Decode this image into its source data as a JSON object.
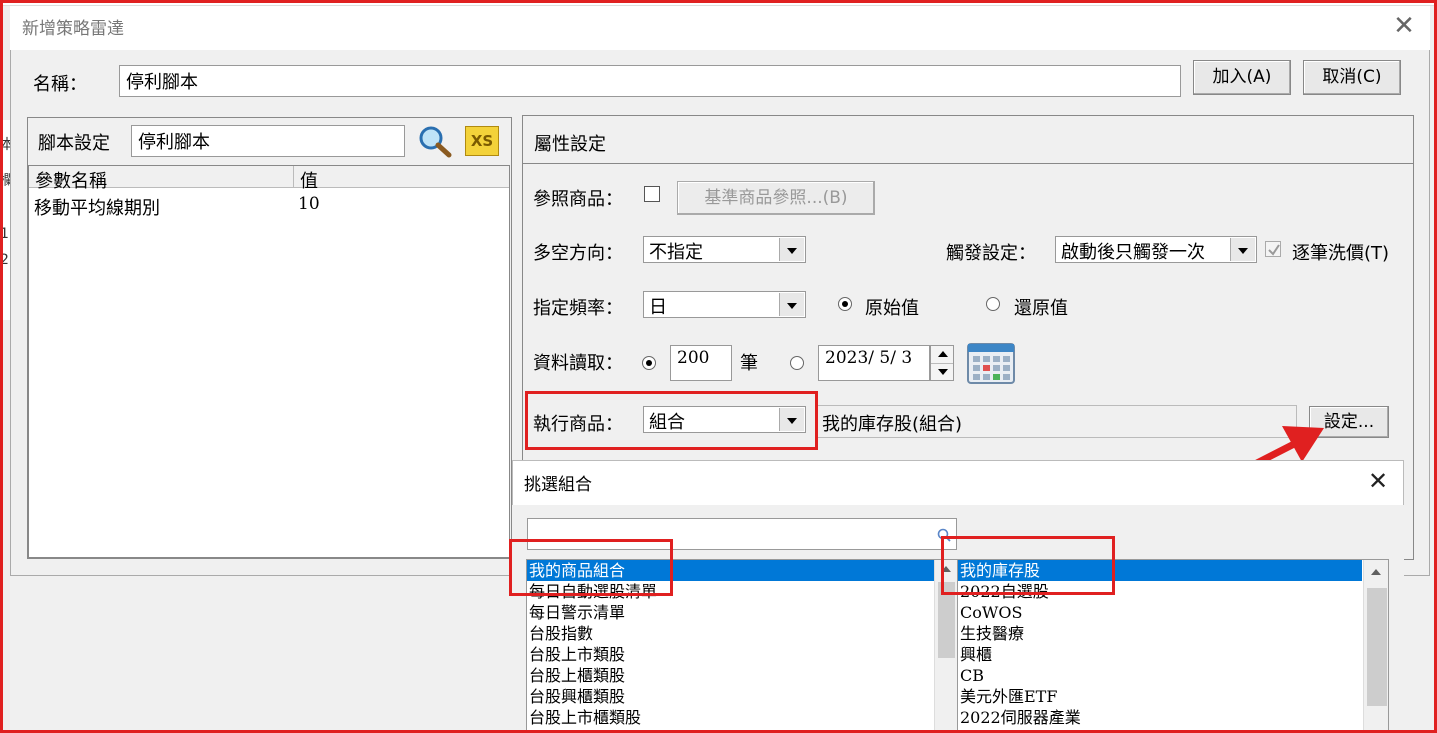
{
  "dialog": {
    "title": "新增策略雷達",
    "name_label": "名稱：",
    "name_value": "停利腳本",
    "add_button": "加入(A)",
    "cancel_button": "取消(C)"
  },
  "script_panel": {
    "label": "腳本設定",
    "script_name": "停利腳本",
    "columns": [
      "參數名稱",
      "值"
    ],
    "rows": [
      {
        "name": "移動平均線期別",
        "value": "10"
      }
    ]
  },
  "property_panel": {
    "title": "屬性設定",
    "ref_label": "參照商品：",
    "ref_button": "基準商品參照...(B)",
    "direction_label": "多空方向：",
    "direction_value": "不指定",
    "trigger_label": "觸發設定：",
    "trigger_value": "啟動後只觸發一次",
    "tick_label": "逐筆洗價(T)",
    "freq_label": "指定頻率：",
    "freq_value": "日",
    "raw_label": "原始值",
    "restore_label": "還原值",
    "data_label": "資料讀取：",
    "bars_value": "200",
    "bars_unit": "筆",
    "date_value": "2023/ 5/ 3",
    "exec_label": "執行商品：",
    "exec_value": "組合",
    "exec_desc": "我的庫存股(組合)",
    "setup_button": "設定..."
  },
  "popup": {
    "title": "挑選組合",
    "search_value": "",
    "left_items": [
      "我的商品組合",
      "每日自動選股清單",
      "每日警示清單",
      "台股指數",
      "台股上市類股",
      "台股上櫃類股",
      "台股興櫃類股",
      "台股上市櫃類股"
    ],
    "right_items": [
      "我的庫存股",
      "2022自選股",
      "CoWOS",
      "生技醫療",
      "興櫃",
      "CB",
      "美元外匯ETF",
      "2022伺服器產業"
    ],
    "arrow": ">"
  },
  "background": {
    "left_chars": [
      "本",
      "欄",
      "1",
      "2"
    ]
  },
  "colors": {
    "highlight": "#0078d7",
    "annotation_red": "#e02020"
  }
}
